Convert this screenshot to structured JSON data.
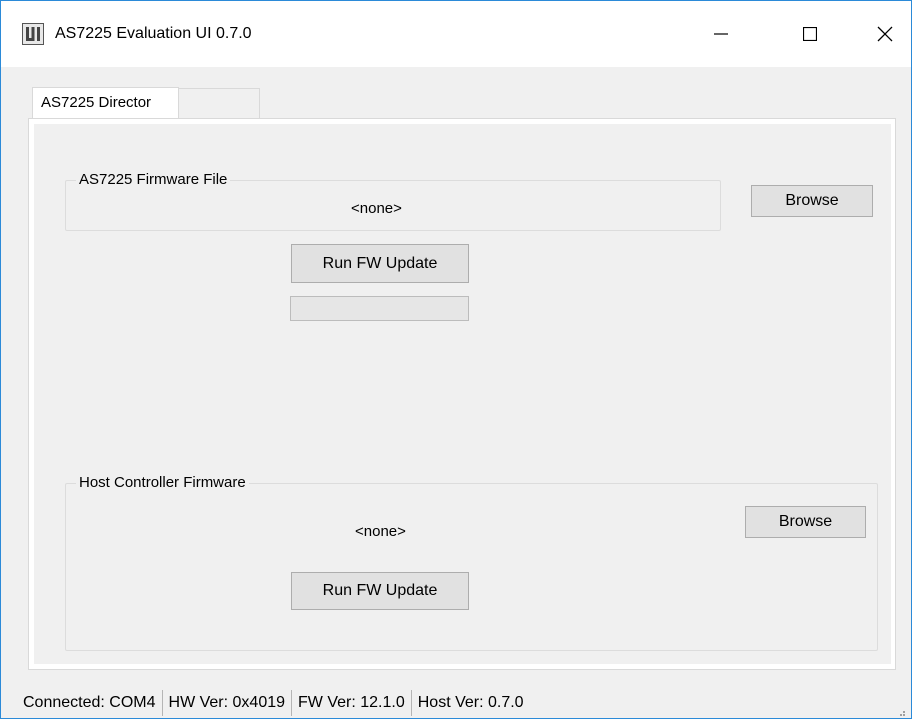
{
  "window": {
    "title": "AS7225 Evaluation UI 0.7.0",
    "icon": "app-logo-icon"
  },
  "tabs": [
    {
      "label": "AS7225 Director",
      "selected": true
    },
    {
      "label": "",
      "selected": false
    }
  ],
  "as7225_firmware": {
    "group_title": "AS7225 Firmware File",
    "file_value": "<none>",
    "browse_label": "Browse",
    "run_label": "Run FW Update",
    "progress": 0
  },
  "host_firmware": {
    "group_title": "Host Controller Firmware",
    "file_value": "<none>",
    "browse_label": "Browse",
    "run_label": "Run FW Update"
  },
  "status": {
    "connected": "Connected: COM4",
    "hw_ver": "HW Ver: 0x4019",
    "fw_ver": "FW Ver: 12.1.0",
    "host_ver": "Host Ver: 0.7.0"
  }
}
